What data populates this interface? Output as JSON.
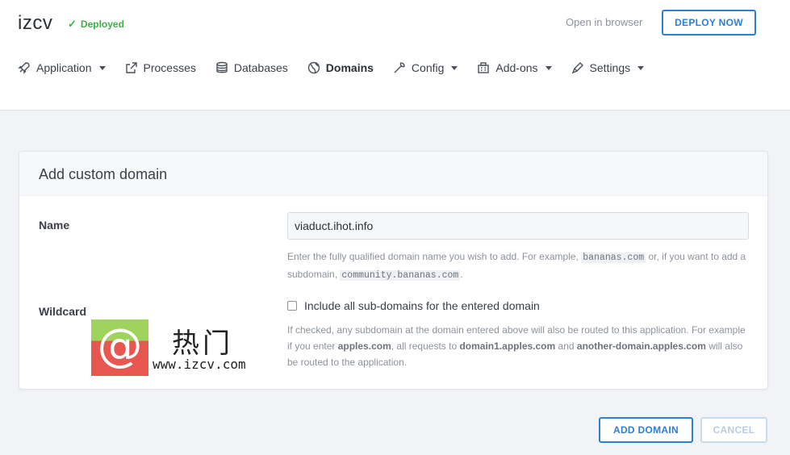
{
  "app": {
    "name": "izcv",
    "status": "Deployed",
    "status_color": "#3fae49"
  },
  "header": {
    "open_browser": "Open in browser",
    "deploy_button": "DEPLOY NOW"
  },
  "nav": [
    {
      "label": "Application",
      "icon": "rocket-icon",
      "dropdown": true,
      "active": false
    },
    {
      "label": "Processes",
      "icon": "external-icon",
      "dropdown": false,
      "active": false
    },
    {
      "label": "Databases",
      "icon": "database-icon",
      "dropdown": false,
      "active": false
    },
    {
      "label": "Domains",
      "icon": "globe-icon",
      "dropdown": false,
      "active": true
    },
    {
      "label": "Config",
      "icon": "wrench-icon",
      "dropdown": true,
      "active": false
    },
    {
      "label": "Add-ons",
      "icon": "building-icon",
      "dropdown": true,
      "active": false
    },
    {
      "label": "Settings",
      "icon": "tag-icon",
      "dropdown": true,
      "active": false
    }
  ],
  "form": {
    "title": "Add custom domain",
    "name_label": "Name",
    "name_value": "viaduct.ihot.info",
    "name_help_1": "Enter the fully qualified domain name you wish to add. For example,",
    "name_help_code1": "bananas.com",
    "name_help_2": "or, if you want to add a subdomain,",
    "name_help_code2": "community.bananas.com",
    "name_help_3": ".",
    "wildcard_label": "Wildcard",
    "wildcard_checkbox_label": "Include all sub-domains for the entered domain",
    "wildcard_help_1": "If checked, any subdomain at the domain entered above will also be routed to this application. For example if you enter",
    "wildcard_help_b1": "apples.com",
    "wildcard_help_2": ", all requests to",
    "wildcard_help_b2": "domain1.apples.com",
    "wildcard_help_3": "and",
    "wildcard_help_b3": "another-domain.apples.com",
    "wildcard_help_4": "will also be routed to the application.",
    "wildcard_checked": false
  },
  "watermark": {
    "symbol": "@",
    "text_cn": "热门",
    "url": "www.izcv.com"
  },
  "actions": {
    "add": "ADD DOMAIN",
    "cancel": "CANCEL"
  },
  "colors": {
    "accent": "#2c7fd1",
    "accent_disabled": "#b7cde3"
  }
}
